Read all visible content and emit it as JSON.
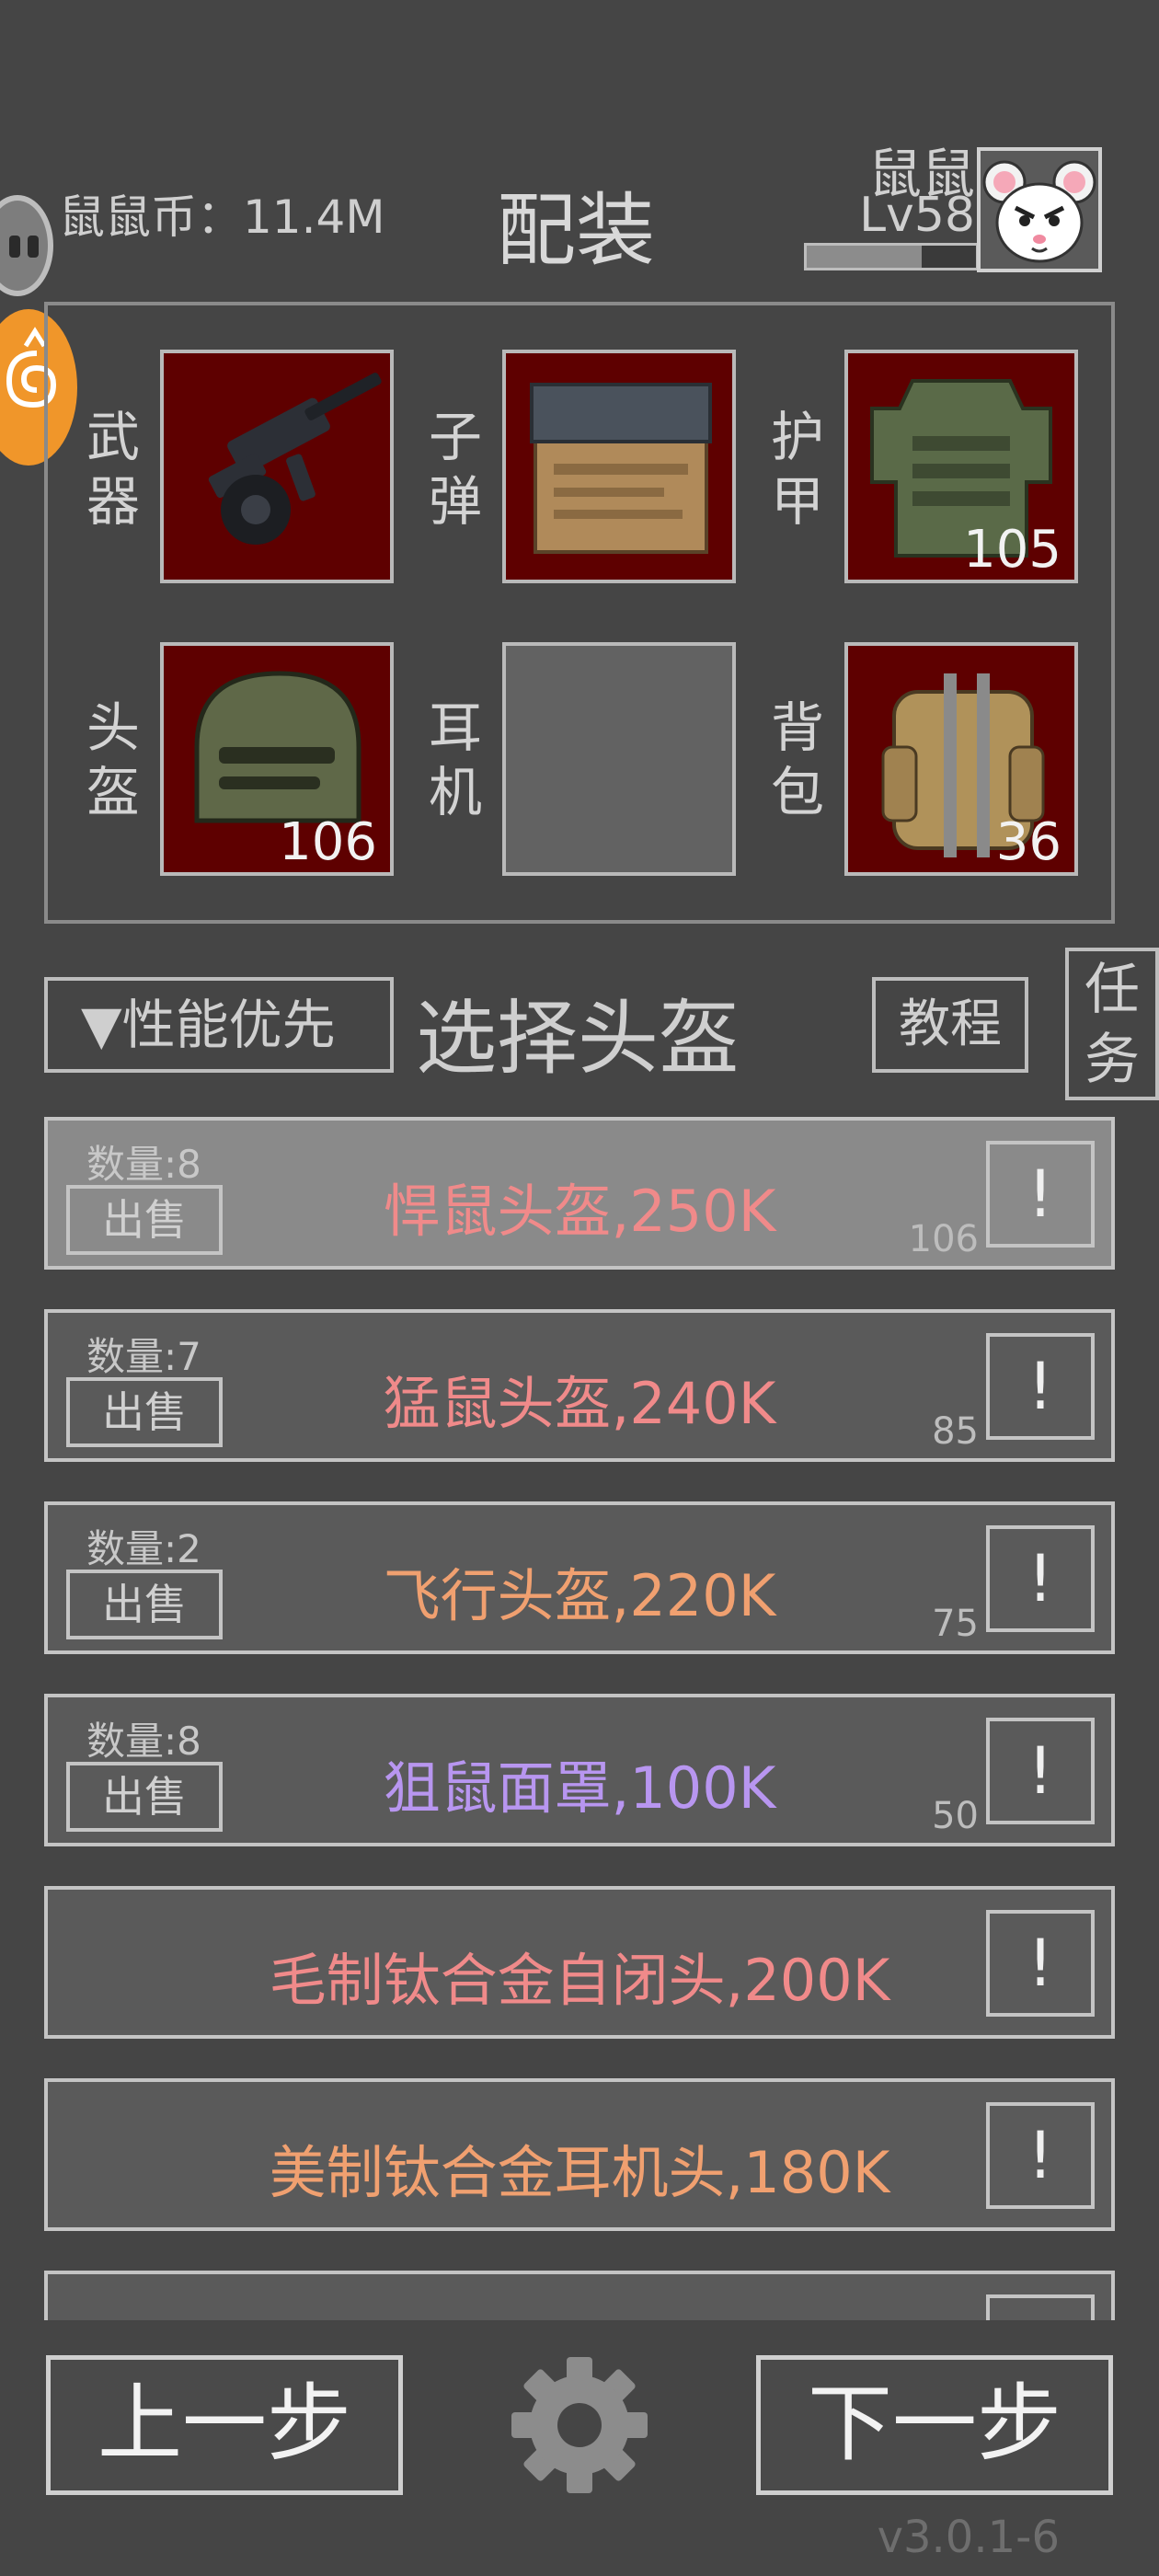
{
  "header": {
    "coins_label": "鼠鼠币：11.4M",
    "title": "配装",
    "player_name": "鼠鼠",
    "player_level": "Lv58",
    "xp_fraction": 0.68
  },
  "equipment": {
    "slots": [
      {
        "label": "武器",
        "value": "",
        "icon": "rifle-icon"
      },
      {
        "label": "子弹",
        "value": "",
        "icon": "ammo-box-icon"
      },
      {
        "label": "护甲",
        "value": "105",
        "icon": "body-armor-icon"
      },
      {
        "label": "头盔",
        "value": "106",
        "icon": "helmet-icon"
      },
      {
        "label": "耳机",
        "value": "",
        "icon": ""
      },
      {
        "label": "背包",
        "value": "36",
        "icon": "backpack-icon"
      }
    ]
  },
  "controls": {
    "filter": "▼性能优先",
    "select_title": "选择头盔",
    "tutorial": "教程",
    "task": "任务"
  },
  "items": [
    {
      "qty": "数量:8",
      "sell": "出售",
      "name": "悍鼠头盔,250K",
      "value": "106",
      "color": "#f08a8a",
      "selected": true
    },
    {
      "qty": "数量:7",
      "sell": "出售",
      "name": "猛鼠头盔,240K",
      "value": "85",
      "color": "#f08a8a",
      "selected": false
    },
    {
      "qty": "数量:2",
      "sell": "出售",
      "name": "飞行头盔,220K",
      "value": "75",
      "color": "#f0a070",
      "selected": false
    },
    {
      "qty": "数量:8",
      "sell": "出售",
      "name": "狙鼠面罩,100K",
      "value": "50",
      "color": "#b896f0",
      "selected": false
    },
    {
      "qty": "",
      "sell": "",
      "name": "毛制钛合金自闭头,200K",
      "value": "",
      "color": "#f08a8a",
      "selected": false
    },
    {
      "qty": "",
      "sell": "",
      "name": "美制钛合金耳机头,180K",
      "value": "",
      "color": "#f0a070",
      "selected": false
    },
    {
      "qty": "",
      "sell": "",
      "name": "",
      "value": "",
      "color": "#f08a8a",
      "selected": false
    }
  ],
  "info_symbol": "!",
  "footer": {
    "prev": "上一步",
    "next": "下一步",
    "version": "v3.0.1-6"
  }
}
